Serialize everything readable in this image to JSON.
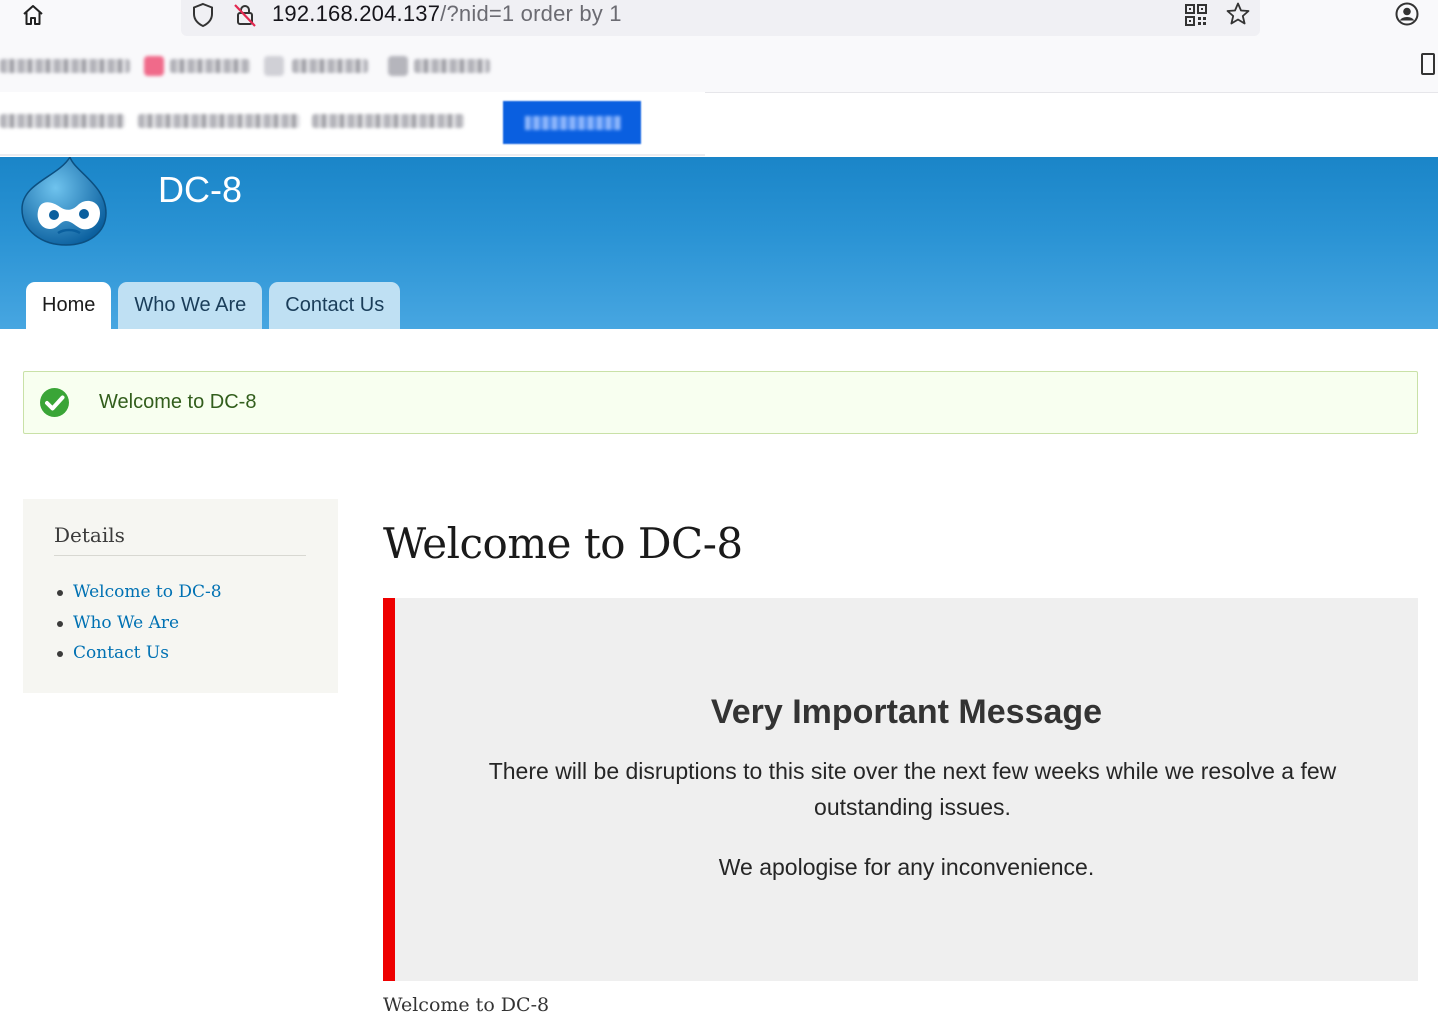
{
  "browser": {
    "url_host": "192.168.204.137",
    "url_path": "/?nid=1 order by 1"
  },
  "site": {
    "name": "DC-8",
    "header_colors": {
      "top": "#1a85c8",
      "bottom": "#47a6e1"
    },
    "tabs": [
      {
        "label": "Home",
        "active": true
      },
      {
        "label": "Who We Are",
        "active": false
      },
      {
        "label": "Contact Us",
        "active": false
      }
    ]
  },
  "status": {
    "icon": "check-circle-icon",
    "text": "Welcome to DC-8",
    "color": "#325e1c"
  },
  "sidebar": {
    "title": "Details",
    "links": [
      {
        "label": "Welcome to DC-8"
      },
      {
        "label": "Who We Are"
      },
      {
        "label": "Contact Us"
      }
    ],
    "link_color": "#0071b3"
  },
  "main": {
    "title": "Welcome to DC-8",
    "message": {
      "heading": "Very Important Message",
      "body": "There will be disruptions to this site over the next few weeks while we resolve a few outstanding issues.",
      "apology": "We apologise for any inconvenience.",
      "accent_color": "#ee0000"
    },
    "body_text": "Welcome to DC-8"
  }
}
